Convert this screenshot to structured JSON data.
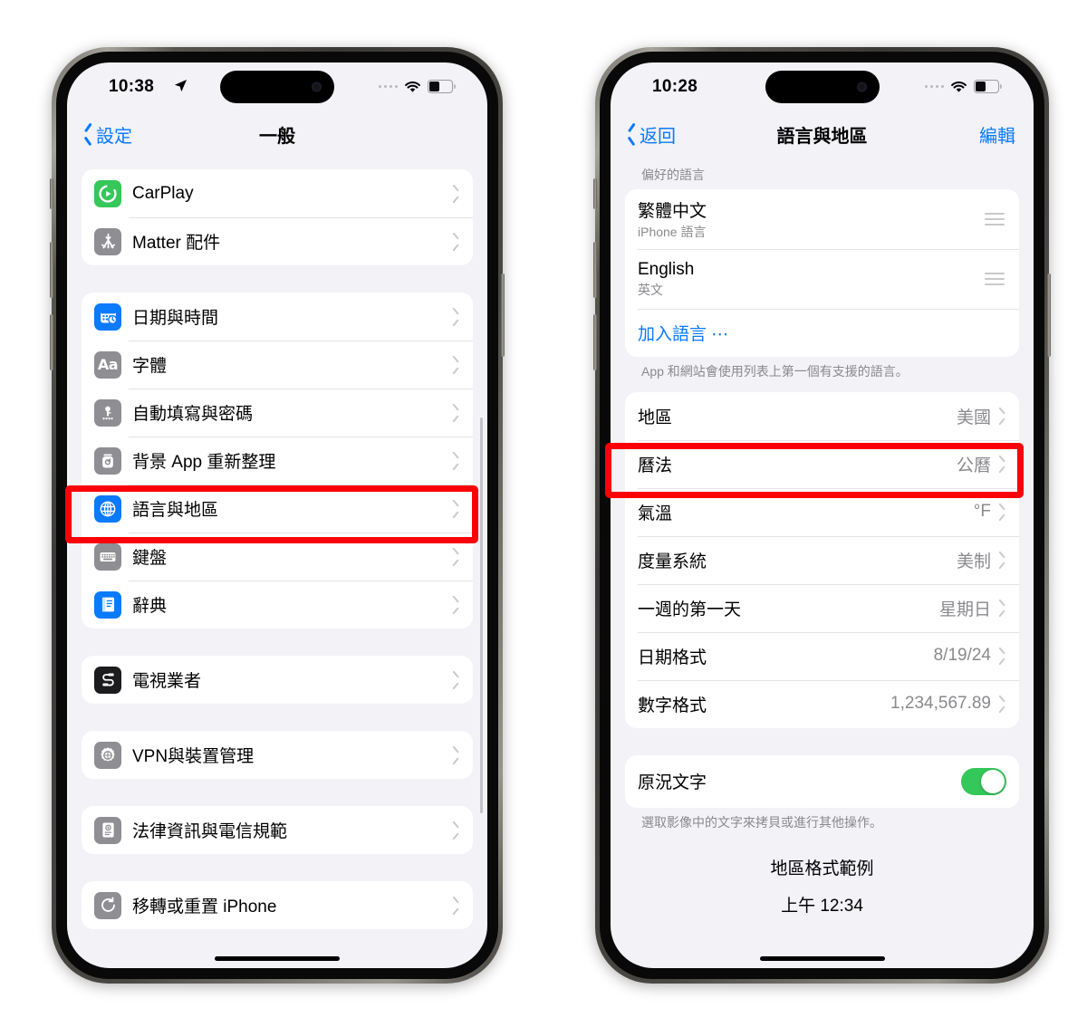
{
  "left_phone": {
    "status": {
      "time": "10:38",
      "location_arrow": "location-arrow-icon",
      "cellular": "cellular-dots",
      "wifi": "wifi-icon",
      "battery": "battery-icon"
    },
    "nav": {
      "back_label": "設定",
      "title": "一般"
    },
    "groups": [
      {
        "rows": [
          {
            "icon": "carplay-icon",
            "icon_color": "#35c759",
            "label": "CarPlay",
            "accessory": "chevron"
          },
          {
            "icon": "matter-icon",
            "icon_color": "#8e8e93",
            "label": "Matter 配件",
            "accessory": "chevron"
          }
        ]
      },
      {
        "rows": [
          {
            "icon": "date-time-icon",
            "icon_color": "#0a7aff",
            "label": "日期與時間",
            "accessory": "chevron"
          },
          {
            "icon": "fonts-icon",
            "icon_color": "#8e8e93",
            "label": "字體",
            "accessory": "chevron"
          },
          {
            "icon": "autofill-password-icon",
            "icon_color": "#8e8e93",
            "label": "自動填寫與密碼",
            "accessory": "chevron"
          },
          {
            "icon": "background-refresh-icon",
            "icon_color": "#8e8e93",
            "label": "背景 App 重新整理",
            "accessory": "chevron"
          },
          {
            "icon": "language-region-icon",
            "icon_color": "#0a7aff",
            "label": "語言與地區",
            "accessory": "chevron",
            "highlighted": true
          },
          {
            "icon": "keyboard-icon",
            "icon_color": "#8e8e93",
            "label": "鍵盤",
            "accessory": "chevron"
          },
          {
            "icon": "dictionary-icon",
            "icon_color": "#0a7aff",
            "label": "辭典",
            "accessory": "chevron"
          }
        ]
      },
      {
        "rows": [
          {
            "icon": "tv-provider-icon",
            "icon_color": "#1c1c1e",
            "label": "電視業者",
            "accessory": "chevron"
          }
        ]
      },
      {
        "rows": [
          {
            "icon": "vpn-device-icon",
            "icon_color": "#8e8e93",
            "label": "VPN與裝置管理",
            "accessory": "chevron"
          }
        ]
      },
      {
        "rows": [
          {
            "icon": "legal-icon",
            "icon_color": "#8e8e93",
            "label": "法律資訊與電信規範",
            "accessory": "chevron"
          }
        ]
      },
      {
        "rows": [
          {
            "icon": "transfer-reset-icon",
            "icon_color": "#8e8e93",
            "label": "移轉或重置 iPhone",
            "accessory": "chevron"
          }
        ]
      }
    ]
  },
  "right_phone": {
    "status": {
      "time": "10:28",
      "cellular": "cellular-dots",
      "wifi": "wifi-icon",
      "battery": "battery-icon"
    },
    "nav": {
      "back_label": "返回",
      "title": "語言與地區",
      "edit_label": "編輯"
    },
    "preferred_languages": {
      "header": "偏好的語言",
      "items": [
        {
          "name": "繁體中文",
          "sub": "iPhone 語言",
          "accessory": "reorder-handle"
        },
        {
          "name": "English",
          "sub": "英文",
          "accessory": "reorder-handle"
        }
      ],
      "add_language": "加入語言 ⋯",
      "footer": "App 和網站會使用列表上第一個有支援的語言。"
    },
    "region_settings": [
      {
        "label": "地區",
        "value": "美國",
        "accessory": "chevron",
        "highlighted": true
      },
      {
        "label": "曆法",
        "value": "公曆",
        "accessory": "chevron"
      },
      {
        "label": "氣溫",
        "value": "°F",
        "accessory": "chevron"
      },
      {
        "label": "度量系統",
        "value": "美制",
        "accessory": "chevron"
      },
      {
        "label": "一週的第一天",
        "value": "星期日",
        "accessory": "chevron"
      },
      {
        "label": "日期格式",
        "value": "8/19/24",
        "accessory": "chevron"
      },
      {
        "label": "數字格式",
        "value": "1,234,567.89",
        "accessory": "chevron"
      }
    ],
    "live_text": {
      "label": "原況文字",
      "toggle_on": true,
      "footer": "選取影像中的文字來拷貝或進行其他操作。"
    },
    "region_example": {
      "title": "地區格式範例",
      "value": "上午 12:34"
    }
  },
  "colors": {
    "accent": "#0a7aff",
    "highlight": "#fb0007",
    "toggle_on": "#34c759",
    "secondary_text": "#8a8a8e"
  }
}
